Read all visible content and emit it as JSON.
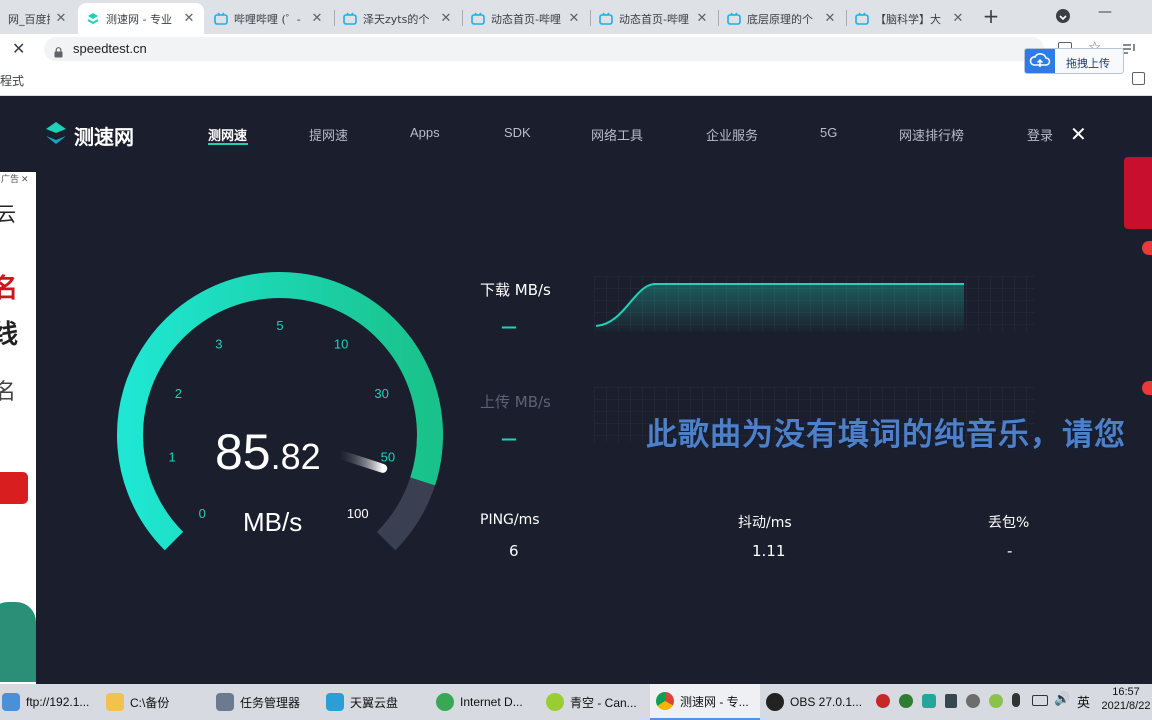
{
  "browser": {
    "tabs": [
      {
        "title": "网_百度搜",
        "active": false
      },
      {
        "title": "测速网 - 专业",
        "active": true
      },
      {
        "title": "哔哩哔哩 (゜-",
        "active": false
      },
      {
        "title": "泽天zyts的个",
        "active": false
      },
      {
        "title": "动态首页-哔哩",
        "active": false
      },
      {
        "title": "动态首页-哔哩",
        "active": false
      },
      {
        "title": "底层原理的个",
        "active": false
      },
      {
        "title": "【脑科学】大",
        "active": false
      }
    ],
    "new_tab": "+",
    "url": "speedtest.cn",
    "bookmark_text": "程式",
    "upload_label": "拖拽上传",
    "window_minimize": "—"
  },
  "site": {
    "logo": "测速网",
    "nav": [
      "测网速",
      "提网速",
      "Apps",
      "SDK",
      "网络工具",
      "企业服务",
      "5G",
      "网速排行榜"
    ],
    "login": "登录",
    "close": "✕",
    "ad_label": "广告",
    "ad_chars": [
      "云",
      "名",
      "线",
      "名"
    ]
  },
  "gauge": {
    "ticks": [
      "0",
      "1",
      "2",
      "3",
      "5",
      "10",
      "30",
      "50",
      "100"
    ],
    "speed_int": "85",
    "speed_dec": ".82",
    "unit": "MB/s",
    "level": 0.9
  },
  "results": {
    "download_label": "下载 MB/s",
    "upload_label": "上传 MB/s",
    "download_value": "—",
    "upload_value": "—",
    "ping_label": "PING/ms",
    "ping_value": "6",
    "jitter_label": "抖动/ms",
    "jitter_value": "1.11",
    "loss_label": "丢包%",
    "loss_value": "-"
  },
  "overlay_subtitle": "此歌曲为没有填词的纯音乐，请您",
  "taskbar": {
    "items": [
      {
        "label": "ftp://192.1...",
        "color": "#4a90d9"
      },
      {
        "label": "C:\\备份",
        "color": "#f2c14e"
      },
      {
        "label": "任务管理器",
        "color": "#6b7a8f"
      },
      {
        "label": "天翼云盘",
        "color": "#2a9fd6"
      },
      {
        "label": "Internet D...",
        "color": "#3aa757"
      },
      {
        "label": "青空 - Can...",
        "color": "#9acd32"
      },
      {
        "label": "测速网 - 专...",
        "color": "#db4437"
      },
      {
        "label": "OBS 27.0.1...",
        "color": "#222222"
      }
    ],
    "ime": "英",
    "time": "16:57",
    "date": "2021/8/22"
  },
  "colors": {
    "accent": "#1fd1b7",
    "bg": "#1b1e2c",
    "gauge_start": "#1fe7d3",
    "gauge_end": "#19b57e"
  }
}
